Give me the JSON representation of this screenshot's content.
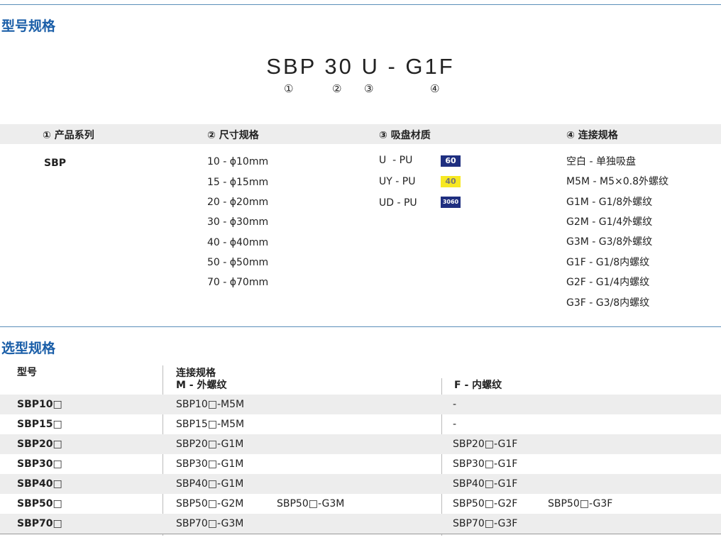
{
  "section1_title": "型号规格",
  "model_code": "SBP 30 U - G1F",
  "code_markers": [
    "①",
    "②",
    "③",
    "④"
  ],
  "spec_headers": [
    "① 产品系列",
    "② 尺寸规格",
    "③ 吸盘材质",
    "④ 连接规格"
  ],
  "series": [
    "SBP"
  ],
  "sizes": [
    "10 - ϕ10mm",
    "15 - ϕ15mm",
    "20 - ϕ20mm",
    "30 - ϕ30mm",
    "40 - ϕ40mm",
    "50 - ϕ50mm",
    "70 - ϕ70mm"
  ],
  "materials": [
    {
      "label": "U  - PU",
      "badge": "60"
    },
    {
      "label": "UY - PU",
      "badge": "40"
    },
    {
      "label": "UD - PU",
      "badge": "3060"
    }
  ],
  "badge_colors": {
    "60": "#1f2f80",
    "40": "#f7e823",
    "3060": "#1f2f80"
  },
  "connections": [
    "空白 - 单独吸盘",
    "M5M - M5×0.8外螺纹",
    "G1M - G1/8外螺纹",
    "G2M - G1/4外螺纹",
    "G3M - G3/8外螺纹",
    "G1F - G1/8内螺纹",
    "G2F - G1/4内螺纹",
    "G3F - G3/8内螺纹"
  ],
  "section2_title": "选型规格",
  "selection": {
    "col_model": "型号",
    "col_conn": "连接规格",
    "col_male": "M - 外螺纹",
    "col_female": "F - 内螺纹",
    "rows": [
      {
        "model": "SBP10□",
        "m1": "SBP10□-M5M",
        "m2": "",
        "f1": "-",
        "f2": ""
      },
      {
        "model": "SBP15□",
        "m1": "SBP15□-M5M",
        "m2": "",
        "f1": "-",
        "f2": ""
      },
      {
        "model": "SBP20□",
        "m1": "SBP20□-G1M",
        "m2": "",
        "f1": "SBP20□-G1F",
        "f2": ""
      },
      {
        "model": "SBP30□",
        "m1": "SBP30□-G1M",
        "m2": "",
        "f1": "SBP30□-G1F",
        "f2": ""
      },
      {
        "model": "SBP40□",
        "m1": "SBP40□-G1M",
        "m2": "",
        "f1": "SBP40□-G1F",
        "f2": ""
      },
      {
        "model": "SBP50□",
        "m1": "SBP50□-G2M",
        "m2": "SBP50□-G3M",
        "f1": "SBP50□-G2F",
        "f2": "SBP50□-G3F"
      },
      {
        "model": "SBP70□",
        "m1": "SBP70□-G3M",
        "m2": "",
        "f1": "SBP70□-G3F",
        "f2": ""
      }
    ]
  },
  "accent_color": "#1a5ea8"
}
